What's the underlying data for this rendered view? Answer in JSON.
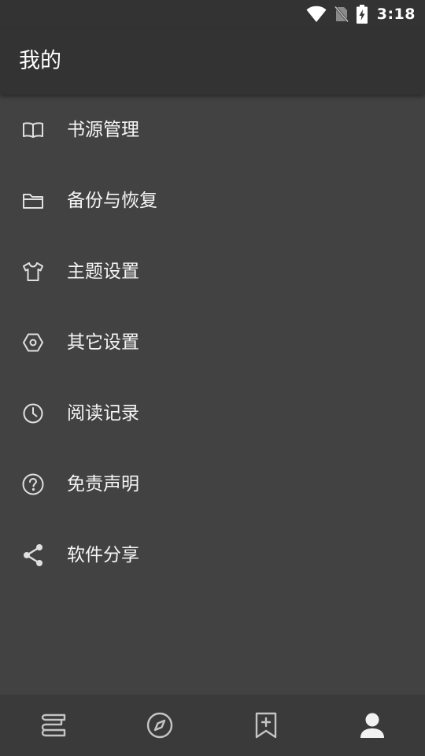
{
  "status_bar": {
    "time": "3:18",
    "icons": [
      "wifi-icon",
      "no-sim-icon",
      "battery-charging-icon"
    ]
  },
  "app_bar": {
    "title": "我的"
  },
  "menu": {
    "items": [
      {
        "label": "书源管理",
        "icon": "book-open-icon"
      },
      {
        "label": "备份与恢复",
        "icon": "folder-icon"
      },
      {
        "label": "主题设置",
        "icon": "tshirt-icon"
      },
      {
        "label": "其它设置",
        "icon": "hexagon-settings-icon"
      },
      {
        "label": "阅读记录",
        "icon": "clock-icon"
      },
      {
        "label": "免责声明",
        "icon": "question-circle-icon"
      },
      {
        "label": "软件分享",
        "icon": "share-icon"
      }
    ]
  },
  "bottom_nav": {
    "items": [
      {
        "icon": "bookshelf-icon",
        "active": false
      },
      {
        "icon": "compass-icon",
        "active": false
      },
      {
        "icon": "bookmark-add-icon",
        "active": false
      },
      {
        "icon": "person-icon",
        "active": true
      }
    ]
  },
  "colors": {
    "background": "#424242",
    "app_bar": "#333333",
    "bottom_nav": "#3a3a3a",
    "text": "#f5f5f5",
    "icon": "#e0e0e0"
  }
}
